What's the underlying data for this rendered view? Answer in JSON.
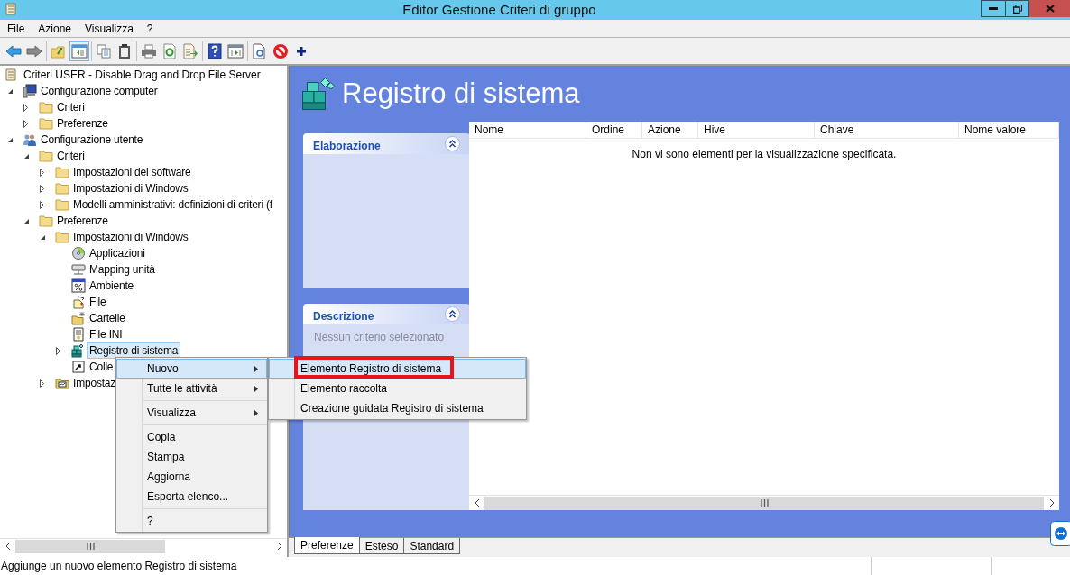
{
  "window": {
    "title": "Editor Gestione Criteri di gruppo"
  },
  "menu_bar": [
    "File",
    "Azione",
    "Visualizza",
    "?"
  ],
  "toolbar": [
    [
      {
        "kind": "back",
        "selected": false
      },
      {
        "kind": "forward",
        "selected": false
      }
    ],
    [
      {
        "kind": "up",
        "selected": false
      },
      {
        "kind": "tree-toggle",
        "selected": true
      }
    ],
    [
      {
        "kind": "copy",
        "selected": false
      },
      {
        "kind": "paste",
        "selected": false
      }
    ],
    [
      {
        "kind": "print",
        "selected": false
      },
      {
        "kind": "refresh",
        "selected": false
      },
      {
        "kind": "export",
        "selected": false
      }
    ],
    [
      {
        "kind": "help",
        "selected": false
      },
      {
        "kind": "pane-toggle",
        "selected": false
      }
    ],
    [
      {
        "kind": "properties",
        "selected": false
      },
      {
        "kind": "stop",
        "selected": false
      },
      {
        "kind": "add",
        "selected": false
      }
    ]
  ],
  "tree": {
    "label": "Criteri USER - Disable Drag and Drop File Server",
    "kind": "policy",
    "selected": false,
    "children": [
      {
        "label": "Configurazione computer",
        "kind": "computer",
        "expanded": true,
        "selected": false,
        "children": [
          {
            "label": "Criteri",
            "kind": "folder",
            "expanded": false,
            "selected": false
          },
          {
            "label": "Preferenze",
            "kind": "folder",
            "expanded": false,
            "selected": false
          }
        ]
      },
      {
        "label": "Configurazione utente",
        "kind": "user",
        "expanded": true,
        "selected": false,
        "children": [
          {
            "label": "Criteri",
            "kind": "folder",
            "expanded": true,
            "selected": false,
            "children": [
              {
                "label": "Impostazioni del software",
                "kind": "folder",
                "expanded": false,
                "selected": false
              },
              {
                "label": "Impostazioni di Windows",
                "kind": "folder",
                "expanded": false,
                "selected": false
              },
              {
                "label": "Modelli amministrativi: definizioni di criteri (f",
                "kind": "folder",
                "expanded": false,
                "selected": false
              }
            ]
          },
          {
            "label": "Preferenze",
            "kind": "folder",
            "expanded": true,
            "selected": false,
            "children": [
              {
                "label": "Impostazioni di Windows",
                "kind": "folder",
                "expanded": true,
                "selected": false,
                "children": [
                  {
                    "label": "Applicazioni",
                    "kind": "disc",
                    "selected": false
                  },
                  {
                    "label": "Mapping unità",
                    "kind": "drive",
                    "selected": false
                  },
                  {
                    "label": "Ambiente",
                    "kind": "percent",
                    "selected": false
                  },
                  {
                    "label": "File",
                    "kind": "file",
                    "selected": false
                  },
                  {
                    "label": "Cartelle",
                    "kind": "folder-new",
                    "selected": false
                  },
                  {
                    "label": "File INI",
                    "kind": "ini",
                    "selected": false
                  },
                  {
                    "label": "Registro di sistema",
                    "kind": "registry",
                    "expanded": false,
                    "selected": true
                  },
                  {
                    "label": "Colle",
                    "kind": "shortcut",
                    "selected": false
                  }
                ]
              },
              {
                "label": "Impostaz",
                "kind": "panel",
                "expanded": false,
                "selected": false
              }
            ]
          }
        ]
      }
    ]
  },
  "content": {
    "title": "Registro di sistema",
    "panels": [
      {
        "title": "Elaborazione",
        "expanded": true
      },
      {
        "title": "Descrizione",
        "expanded": true,
        "text": "Nessun criterio selezionato"
      }
    ],
    "table": {
      "columns": [
        "Nome",
        "Ordine",
        "Azione",
        "Hive",
        "Chiave",
        "Nome valore"
      ],
      "empty_message": "Non vi sono elementi per la visualizzazione specificata."
    },
    "tabs": [
      {
        "label": "Preferenze",
        "selected": true
      },
      {
        "label": "Esteso",
        "selected": false
      },
      {
        "label": "Standard",
        "selected": false
      }
    ]
  },
  "context_menu": {
    "groups": [
      [
        {
          "label": "Nuovo",
          "submenu": true,
          "selected": true
        },
        {
          "label": "Tutte le attività",
          "submenu": true,
          "selected": false
        }
      ],
      [
        {
          "label": "Visualizza",
          "submenu": true,
          "selected": false
        }
      ],
      [
        {
          "label": "Copia",
          "submenu": false,
          "selected": false
        },
        {
          "label": "Stampa",
          "submenu": false,
          "selected": false
        },
        {
          "label": "Aggiorna",
          "submenu": false,
          "selected": false
        },
        {
          "label": "Esporta elenco...",
          "submenu": false,
          "selected": false
        }
      ],
      [
        {
          "label": "?",
          "submenu": false,
          "selected": false
        }
      ]
    ]
  },
  "submenu": {
    "items": [
      {
        "label": "Elemento Registro di sistema",
        "selected": true,
        "annotated": true
      },
      {
        "label": "Elemento raccolta",
        "selected": false,
        "annotated": false
      },
      {
        "label": "Creazione guidata Registro di sistema",
        "selected": false,
        "annotated": false
      }
    ]
  },
  "status_bar": {
    "text": "Aggiunge un nuovo elemento Registro di sistema"
  }
}
